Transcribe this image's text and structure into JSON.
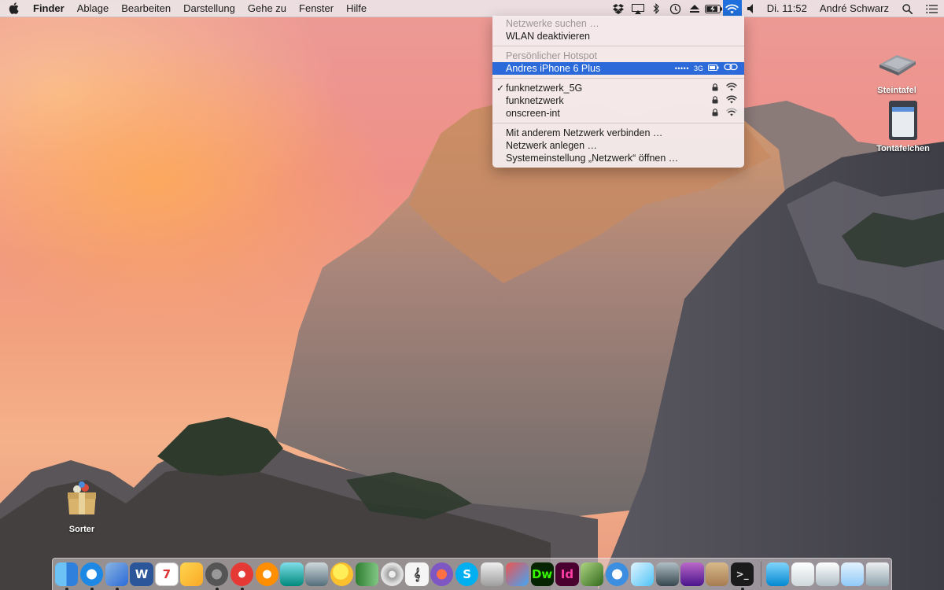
{
  "menubar": {
    "app_name": "Finder",
    "items": [
      "Ablage",
      "Bearbeiten",
      "Darstellung",
      "Gehe zu",
      "Fenster",
      "Hilfe"
    ],
    "status_icons": [
      "dropbox-icon",
      "airplay-icon",
      "bluetooth-icon",
      "time-machine-icon",
      "eject-icon",
      "battery-icon",
      "wifi-icon",
      "volume-icon"
    ],
    "clock": "Di. 11:52",
    "user": "André Schwarz"
  },
  "wifi_menu": {
    "searching": "Netzwerke suchen …",
    "toggle": "WLAN deaktivieren",
    "hotspot_header": "Persönlicher Hotspot",
    "hotspot": {
      "name": "Andres iPhone 6 Plus",
      "signal": "•••••",
      "network_type": "3G"
    },
    "networks": [
      {
        "name": "funknetzwerk_5G",
        "connected": true,
        "locked": true,
        "signal_bars": 3
      },
      {
        "name": "funknetzwerk",
        "connected": false,
        "locked": true,
        "signal_bars": 3
      },
      {
        "name": "onscreen-int",
        "connected": false,
        "locked": true,
        "signal_bars": 2
      }
    ],
    "check_glyph": "✓",
    "actions": [
      "Mit anderem Netzwerk verbinden …",
      "Netzwerk anlegen …",
      "Systemeinstellung „Netzwerk“ öffnen …"
    ]
  },
  "desktop_icons": {
    "steintafel": "Steintafel",
    "tontafelchen": "Tontäfelchen",
    "sorter": "Sorter"
  },
  "dock": {
    "colors": {
      "finder": "#3a8ee6",
      "safari": "#1e88e5",
      "word": "#2b579a",
      "music": "#e53935",
      "accent": "#2b6ad8"
    },
    "glyphs": {
      "word": "W",
      "calendar": "7",
      "dreamweaver": "Dw",
      "indesign": "Id",
      "skype": "S"
    }
  }
}
